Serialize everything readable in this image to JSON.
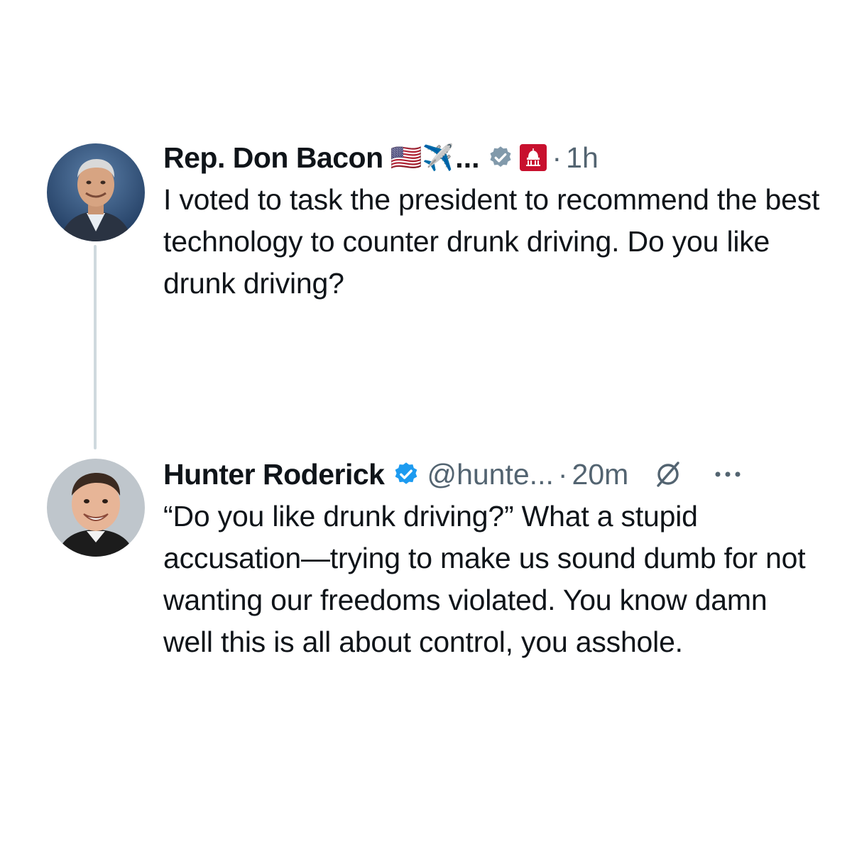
{
  "thread": {
    "tweets": [
      {
        "author_name": "Rep. Don Bacon",
        "name_emoji": "🇺🇸✈️",
        "name_truncation": "...",
        "verified": "gray-check-badge",
        "affiliation_badge": "house-gop-badge",
        "separator": "·",
        "time": "1h",
        "text": "I voted to task the president to recommend the best technology to counter drunk driving. Do you like drunk driving?"
      },
      {
        "author_name": "Hunter Roderick",
        "verified": "blue-check-badge",
        "handle": "@hunte...",
        "separator": "·",
        "time": "20m",
        "grok_icon": "grok-icon",
        "more_icon": "more-icon",
        "text": "“Do you like drunk driving?” What a stupid accusation—trying to make us sound dumb for not wanting our freedoms violated. You know damn well this is all about control, you asshole."
      }
    ]
  },
  "colors": {
    "text": "#0f1419",
    "secondary": "#536471",
    "verified_blue": "#1d9bf0",
    "verified_gray": "#829aab",
    "gop_red": "#c8102e",
    "thread_line": "#cfd9de"
  }
}
